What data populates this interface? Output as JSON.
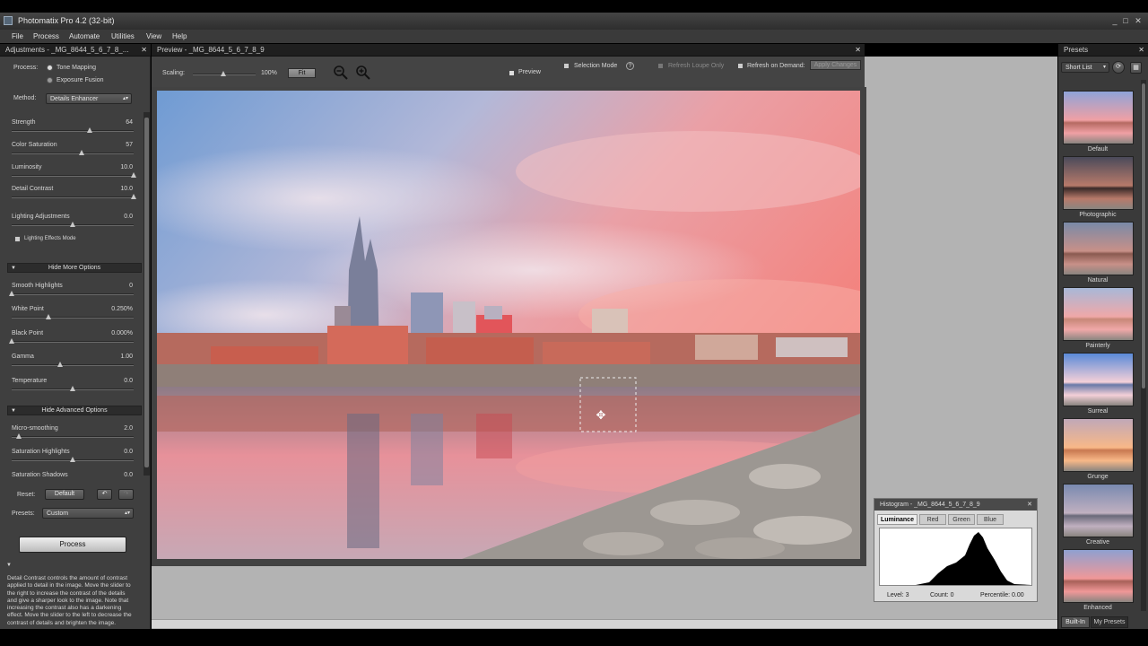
{
  "window": {
    "title": "Photomatix Pro 4.2 (32-bit)"
  },
  "menu": [
    "File",
    "Process",
    "Automate",
    "Utilities",
    "View",
    "Help"
  ],
  "adjustments": {
    "panel_title": "Adjustments - _MG_8644_5_6_7_8_...",
    "process_label": "Process:",
    "process_options": [
      "Tone Mapping",
      "Exposure Fusion"
    ],
    "process_selected": "Tone Mapping",
    "method_label": "Method:",
    "method_value": "Details Enhancer",
    "sliders": [
      {
        "label": "Strength",
        "value": "64",
        "fraction": 0.64
      },
      {
        "label": "Color Saturation",
        "value": "57",
        "fraction": 0.57
      },
      {
        "label": "Luminosity",
        "value": "10.0",
        "fraction": 1.0
      },
      {
        "label": "Detail Contrast",
        "value": "10.0",
        "fraction": 1.0
      },
      {
        "label": "Lighting Adjustments",
        "value": "0.0",
        "fraction": 0.5
      }
    ],
    "lighting_effects_label": "Lighting Effects Mode",
    "more_options_header": "Hide More Options",
    "more_sliders": [
      {
        "label": "Smooth Highlights",
        "value": "0",
        "fraction": 0.0
      },
      {
        "label": "White Point",
        "value": "0.250%",
        "fraction": 0.3
      },
      {
        "label": "Black Point",
        "value": "0.000%",
        "fraction": 0.0
      },
      {
        "label": "Gamma",
        "value": "1.00",
        "fraction": 0.4
      },
      {
        "label": "Temperature",
        "value": "0.0",
        "fraction": 0.5
      }
    ],
    "advanced_header": "Hide Advanced Options",
    "advanced_sliders": [
      {
        "label": "Micro-smoothing",
        "value": "2.0",
        "fraction": 0.06
      },
      {
        "label": "Saturation Highlights",
        "value": "0.0",
        "fraction": 0.5
      },
      {
        "label": "Saturation Shadows",
        "value": "0.0",
        "fraction": 0.5
      }
    ],
    "reset_label": "Reset:",
    "reset_value": "Default",
    "presets_label": "Presets:",
    "presets_value": "Custom",
    "process_button": "Process",
    "help_text": "Detail Contrast controls the amount of contrast applied to detail in the image. Move the slider to the right to increase the contrast of the details and give a sharper look to the image. Note that increasing the contrast also has a darkening effect. Move the slider to the left to decrease the contrast of details and brighten the image."
  },
  "preview": {
    "panel_title": "Preview - _MG_8644_5_6_7_8_9",
    "scaling_label": "Scaling:",
    "scaling_value": "100%",
    "fit_label": "Fit",
    "preview_label": "Preview",
    "selection_mode_label": "Selection Mode",
    "refresh_loupe_label": "Refresh Loupe Only",
    "refresh_on_demand_label": "Refresh on Demand:",
    "apply_changes_label": "Apply Changes"
  },
  "histogram": {
    "title": "Histogram - _MG_8644_5_6_7_8_9",
    "tabs": [
      "Luminance",
      "Red",
      "Green",
      "Blue"
    ],
    "active_tab": "Luminance",
    "level": "Level: 3",
    "count": "Count: 0",
    "percentile": "Percentile: 0.00"
  },
  "presets_panel": {
    "title": "Presets",
    "view_mode": "Short List",
    "items": [
      "Default",
      "Photographic",
      "Natural",
      "Painterly",
      "Surreal",
      "Grunge",
      "Creative",
      "Enhanced"
    ],
    "tabs": [
      "Built-In",
      "My Presets"
    ]
  },
  "colors": {
    "panel_bg": "#3f3f3f",
    "preview_bg": "#b3b3b3",
    "sky_pink": "#f08a86",
    "sky_blue": "#7fa6d6"
  }
}
